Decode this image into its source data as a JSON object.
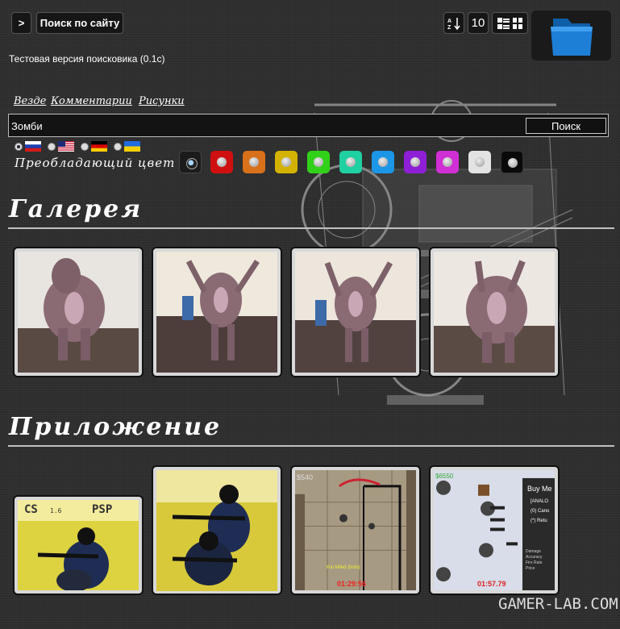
{
  "header": {
    "arrow_label": ">",
    "site_search_label": "Поиск по сайту",
    "subtitle": "Тестовая версия поисковика (0.1с)",
    "tools": {
      "sort_icon": "sort-az-icon",
      "count_label": "10",
      "layout_icon": "view-layout-icon"
    },
    "folder_icon": "folder-icon",
    "folder_color": "#1e7fd6"
  },
  "scopes": [
    "Везде",
    "Комментарии",
    "Рисунки"
  ],
  "search": {
    "value": "Зомби",
    "button_label": "Поиск"
  },
  "languages": [
    {
      "name": "ru",
      "selected": true
    },
    {
      "name": "us",
      "selected": false
    },
    {
      "name": "de",
      "selected": false
    },
    {
      "name": "ua",
      "selected": false
    }
  ],
  "color_filter": {
    "label": "Преобладающий цвет :",
    "swatches": [
      "none",
      "#d01010",
      "#d9701a",
      "#d4b300",
      "#31d11a",
      "#1fd0a0",
      "#1c96e6",
      "#8f1fd6",
      "#d12fd6",
      "#e3e3e3",
      "#0a0a0a"
    ],
    "selected_index": 0
  },
  "gallery": {
    "title": "Галерея",
    "items": [
      "zombie-figure-photo-1",
      "zombie-figure-photo-2",
      "zombie-figure-photo-3",
      "zombie-figure-photo-4"
    ]
  },
  "apps": {
    "title": "Приложение",
    "items": [
      {
        "id": "cs-psp-cover",
        "overlay_left": "CS",
        "overlay_mid": "1.6",
        "overlay_right": "PSP"
      },
      {
        "id": "cs-soldiers-art"
      },
      {
        "id": "cs-mobile-screenshot-1",
        "money": "$540",
        "kill_text": "You killed (bots)",
        "timer": "01:29:56"
      },
      {
        "id": "cs-mobile-screenshot-2",
        "money": "$6550",
        "menu_title": "Buy Me",
        "menu_items": [
          "[ANALO",
          "(0) Cano",
          "(*) Retu"
        ],
        "stats": [
          "Damage",
          "Accuracy",
          "Fire Rate",
          "Price"
        ],
        "timer": "01:57.79"
      }
    ]
  },
  "watermark": "GAMER-LAB.COM"
}
